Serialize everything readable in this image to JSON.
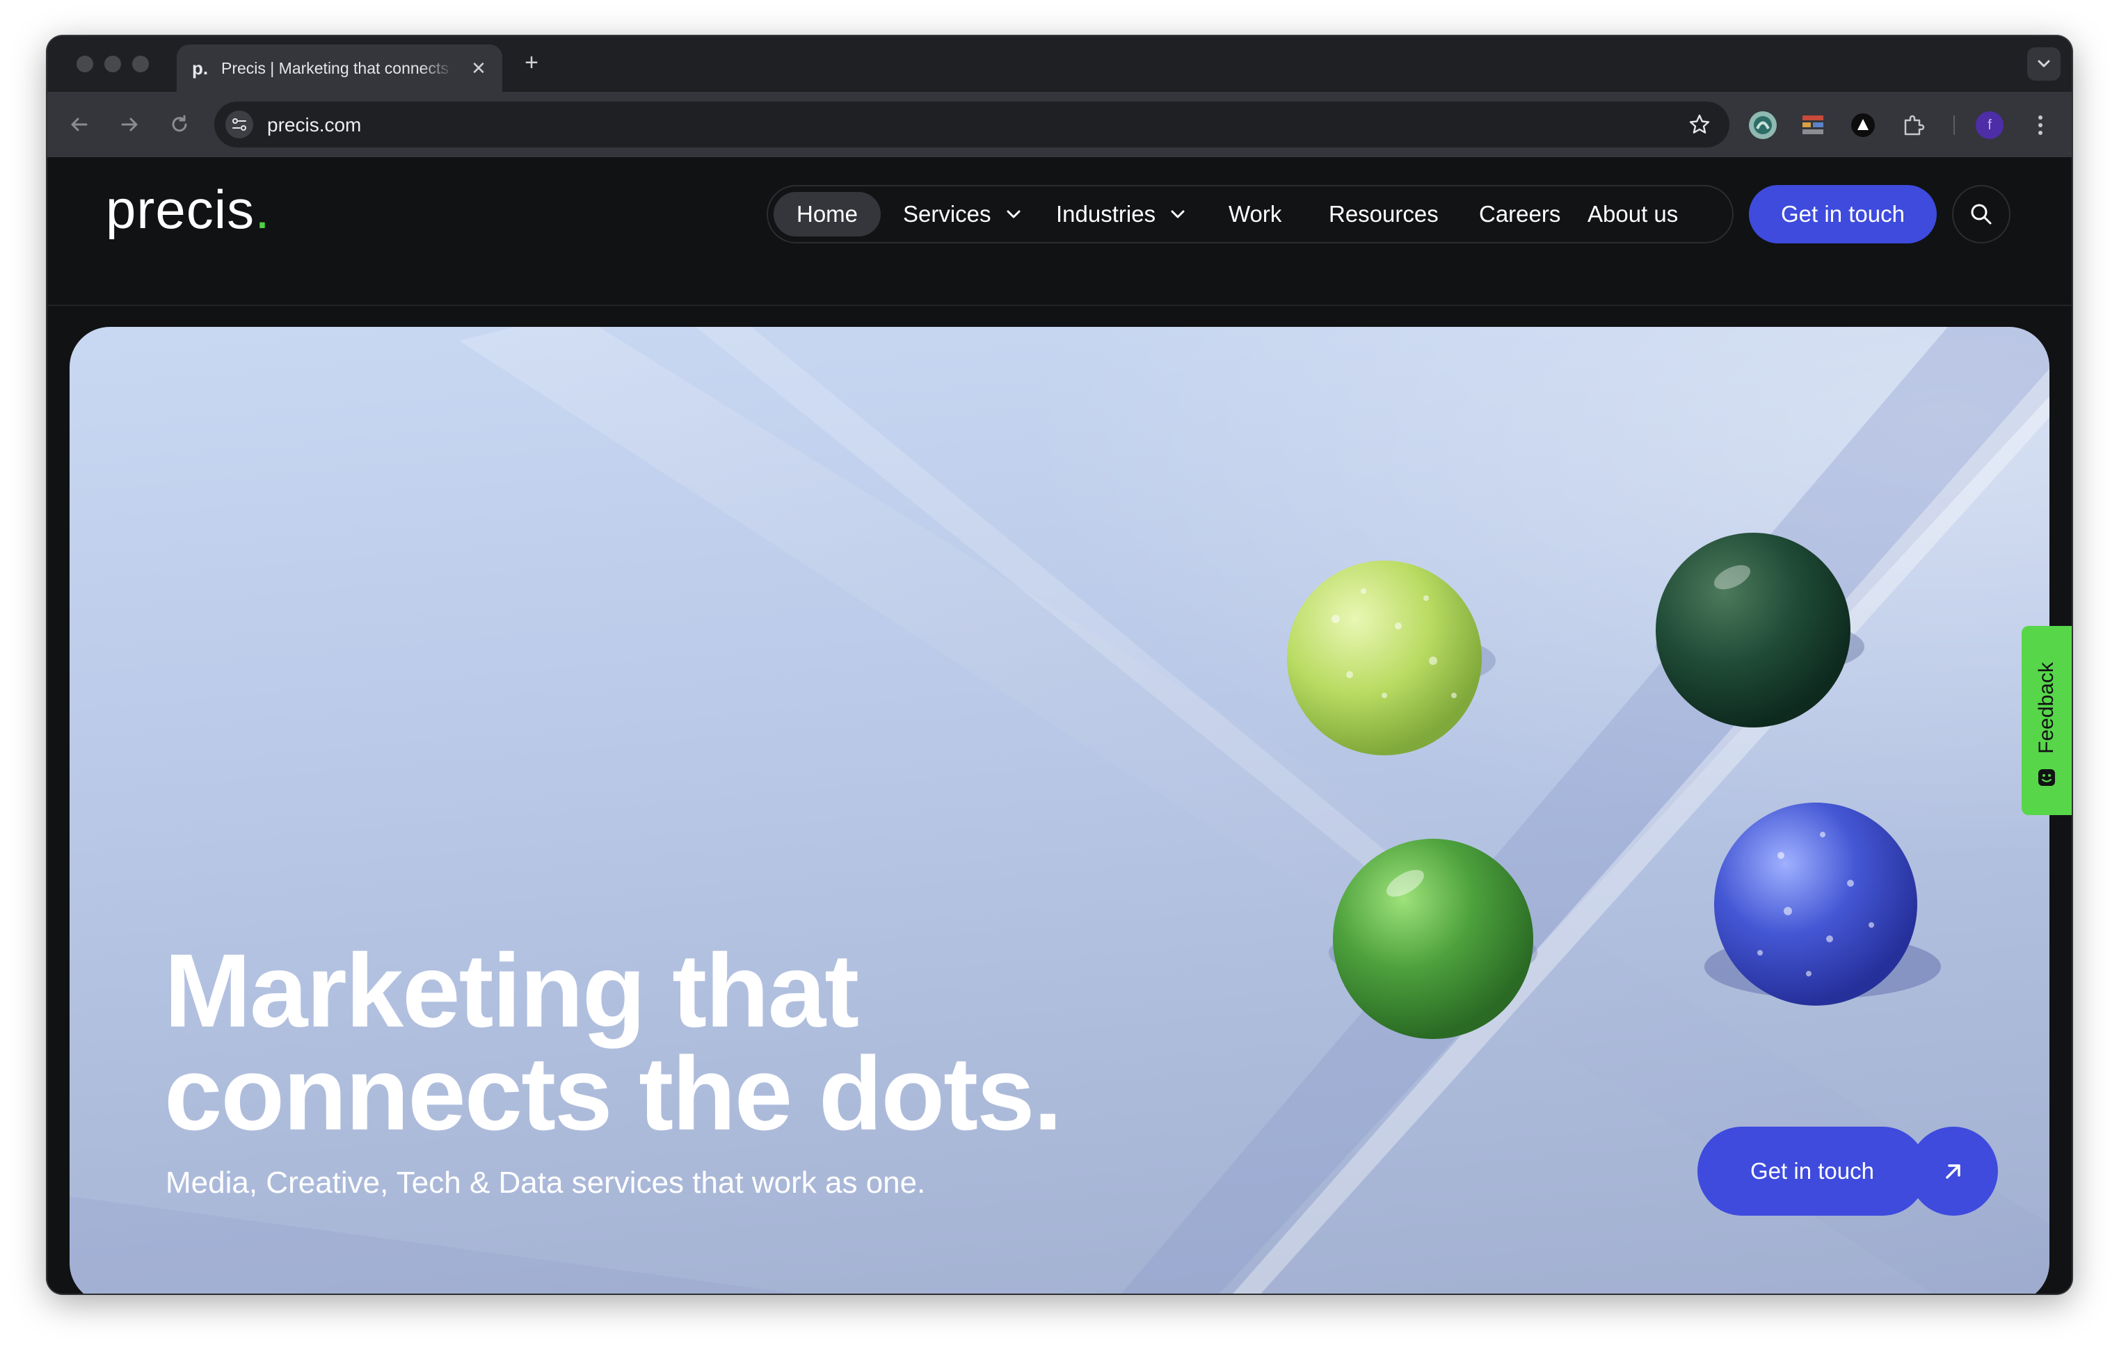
{
  "browser": {
    "tab_title": "Precis | Marketing that connects the dots",
    "tab_favicon": "p.",
    "new_tab_symbol": "+",
    "close_symbol": "✕",
    "url": "precis.com",
    "profile_initial": "f"
  },
  "site": {
    "logo_text": "precis",
    "logo_dot": ".",
    "nav": {
      "home": "Home",
      "services": "Services",
      "industries": "Industries",
      "work": "Work",
      "resources": "Resources",
      "careers": "Careers",
      "about": "About us"
    },
    "header_cta": "Get in touch"
  },
  "hero": {
    "title_line1": "Marketing that",
    "title_line2": "connects the dots.",
    "subtitle": "Media, Creative, Tech & Data services that work as one.",
    "cta_label": "Get in touch"
  },
  "feedback": {
    "label": "Feedback"
  },
  "colors": {
    "brand_blue": "#3e4bdd",
    "brand_green": "#4cd33f",
    "feedback_green": "#57d64a"
  },
  "icons": [
    "back-arrow-icon",
    "forward-arrow-icon",
    "reload-icon",
    "site-settings-icon",
    "bookmark-star-icon",
    "extensions-puzzle-icon",
    "search-icon",
    "chevron-down-icon",
    "arrow-up-right-icon",
    "smiley-icon"
  ]
}
